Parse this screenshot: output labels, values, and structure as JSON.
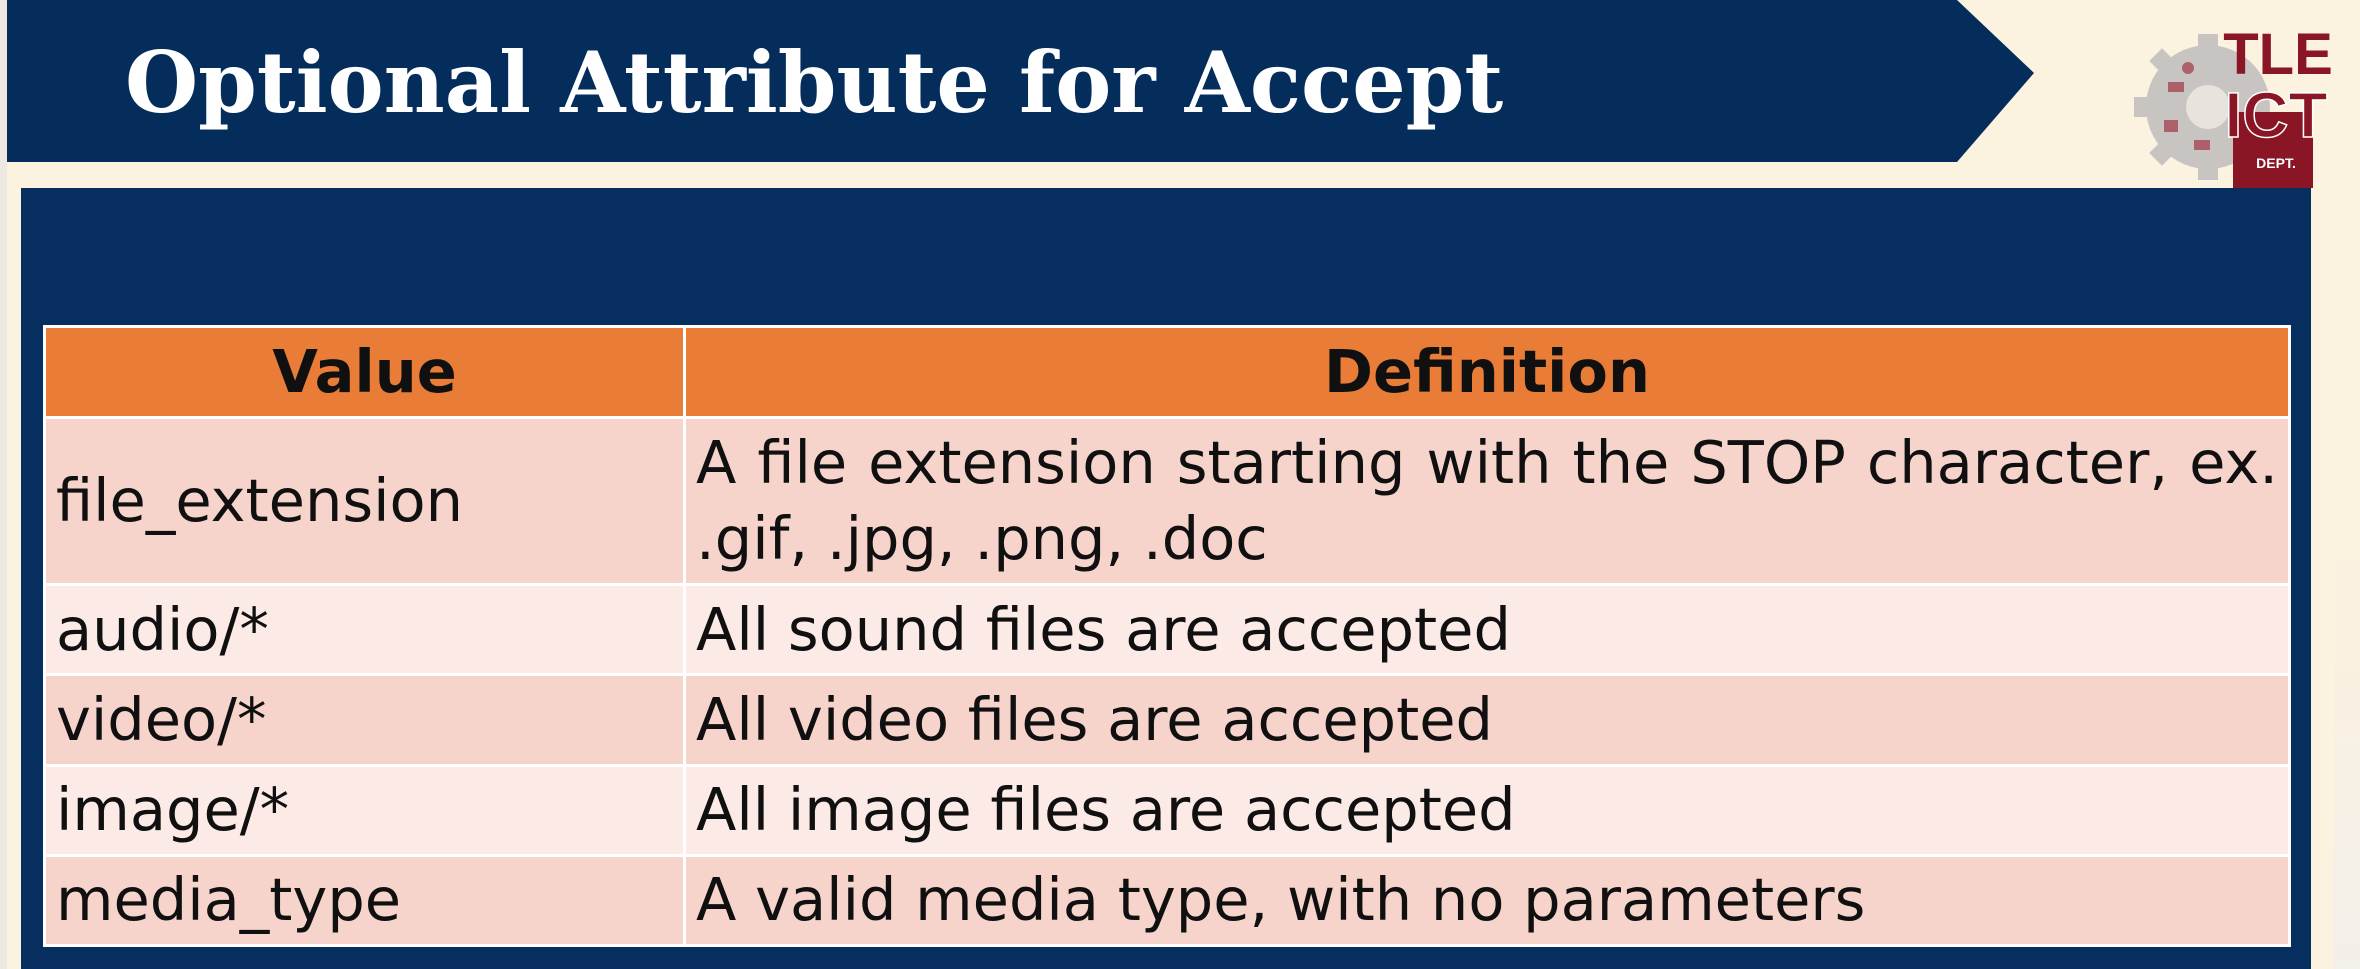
{
  "slide": {
    "title": "Optional Attribute for Accept"
  },
  "logo": {
    "line1": "TLE",
    "line2": "ICT",
    "line3": "DEPT.",
    "colors": {
      "gear": "#c8c4c1",
      "text": "#8a1524"
    }
  },
  "table": {
    "headers": [
      "Value",
      "Definition"
    ],
    "rows": [
      {
        "value": "file_extension",
        "definition": "A file extension starting with the STOP character, ex.  .gif, .jpg, .png, .doc"
      },
      {
        "value": "audio/*",
        "definition": "All sound files are accepted"
      },
      {
        "value": "video/*",
        "definition": "All video files are accepted"
      },
      {
        "value": "image/*",
        "definition": "All image files are accepted"
      },
      {
        "value": "media_type",
        "definition": "A valid media type, with no parameters"
      }
    ]
  },
  "colors": {
    "navy": "#042d5c",
    "background": "#fbf2df",
    "header_orange": "#e97d37",
    "row_dark": "#f6d4cb",
    "row_light": "#fbeae6"
  }
}
